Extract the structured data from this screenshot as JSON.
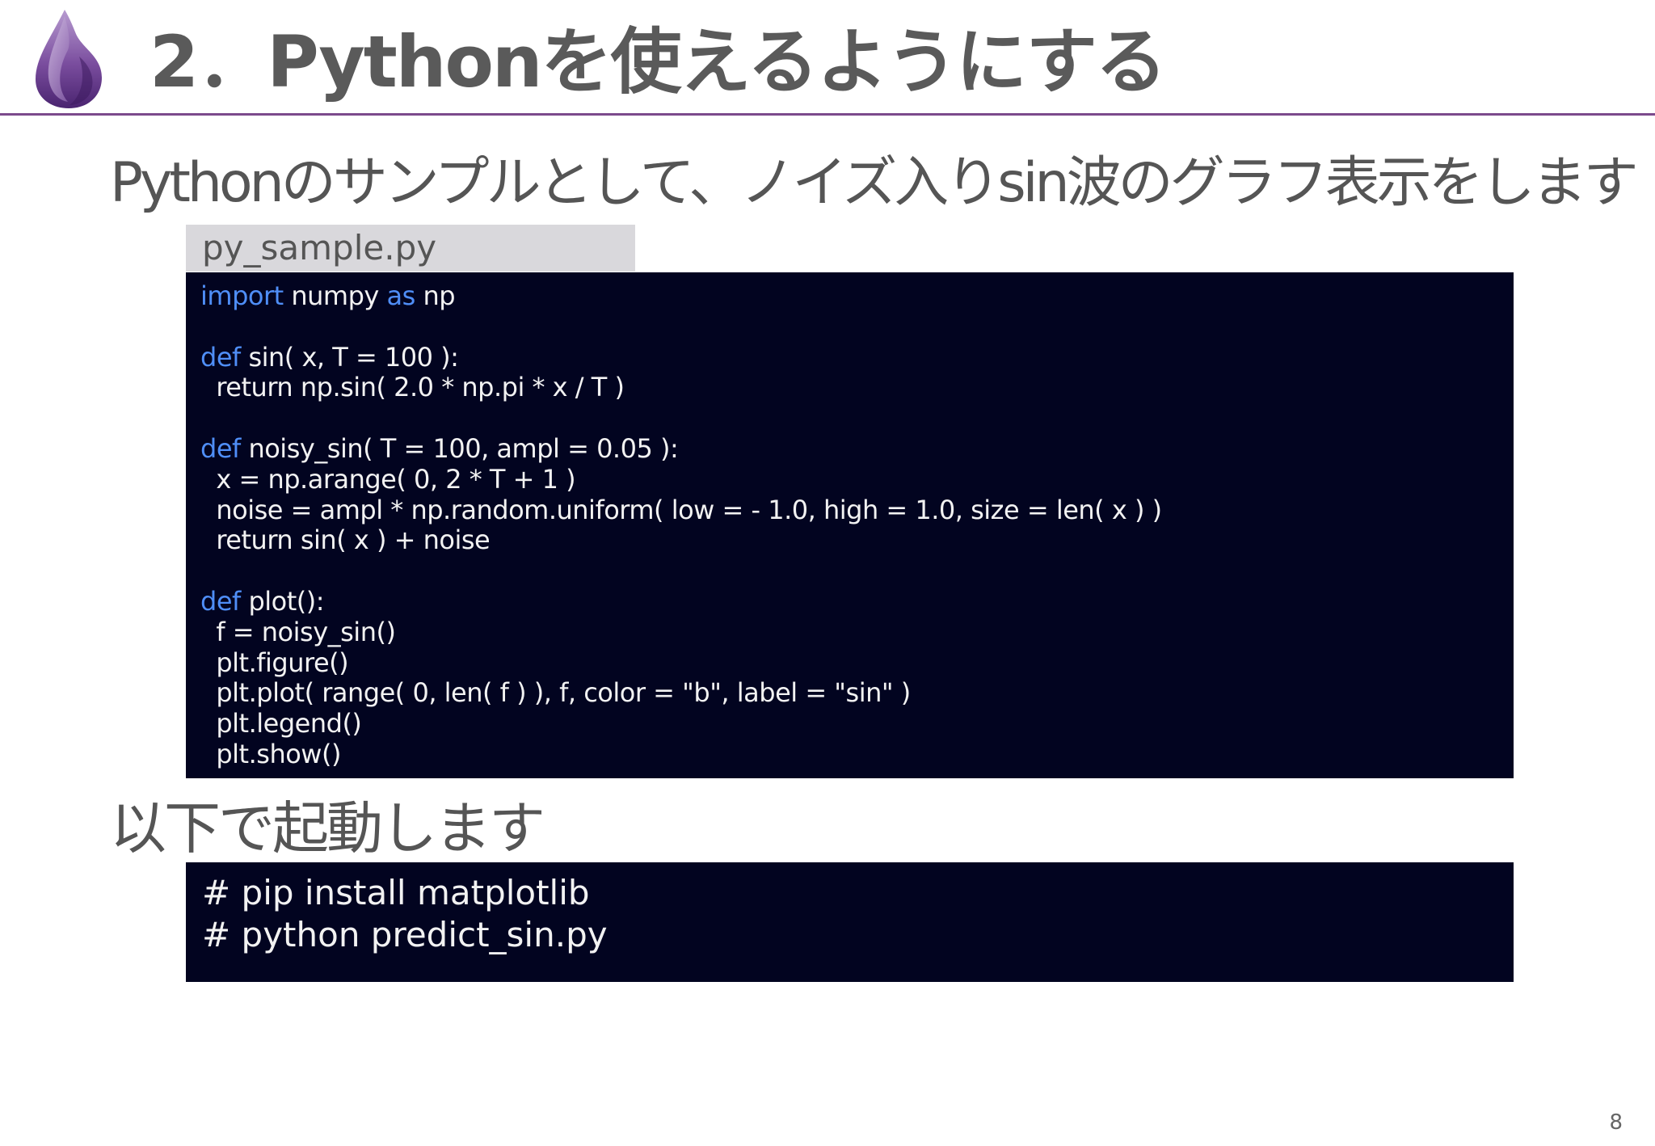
{
  "header": {
    "title": "2．Pythonを使えるようにする"
  },
  "subtitle": "Pythonのサンプルとして、ノイズ入りsin波のグラフ表示をします",
  "code_tab": {
    "filename": "py_sample.py"
  },
  "code": {
    "lines": [
      [
        {
          "kw": "import"
        },
        {
          "t": " numpy "
        },
        {
          "kw": "as"
        },
        {
          "t": " np"
        }
      ],
      [],
      [
        {
          "kw": "def"
        },
        {
          "t": " sin( x, T = 100 ):"
        }
      ],
      [
        {
          "t": "  return np.sin( 2.0 * np.pi * x / T )"
        }
      ],
      [],
      [
        {
          "kw": "def"
        },
        {
          "t": " noisy_sin( T = 100, ampl = 0.05 ):"
        }
      ],
      [
        {
          "t": "  x = np.arange( 0, 2 * T + 1 )"
        }
      ],
      [
        {
          "t": "  noise = ampl * np.random.uniform( low = - 1.0, high = 1.0, size = len( x ) )"
        }
      ],
      [
        {
          "t": "  return sin( x ) + noise"
        }
      ],
      [],
      [
        {
          "kw": "def"
        },
        {
          "t": " plot():"
        }
      ],
      [
        {
          "t": "  f = noisy_sin()"
        }
      ],
      [
        {
          "t": "  plt.figure()"
        }
      ],
      [
        {
          "t": "  plt.plot( range( 0, len( f ) ), f, color = \"b\", label = \"sin\" )"
        }
      ],
      [
        {
          "t": "  plt.legend()"
        }
      ],
      [
        {
          "t": "  plt.show()"
        }
      ]
    ]
  },
  "section2": {
    "heading": "以下で起動します"
  },
  "commands": {
    "lines": [
      "# pip install matplotlib",
      "# python predict_sin.py"
    ]
  },
  "footer": {
    "page_number": "8"
  },
  "colors": {
    "code_background": "#020420",
    "keyword": "#4f8ef7",
    "title_rule": "#7b4a8c"
  },
  "icons": {
    "logo": "purple-drop-logo-icon"
  }
}
